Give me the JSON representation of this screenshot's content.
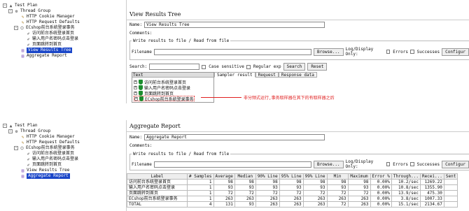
{
  "top": {
    "tree": [
      {
        "label": "Test Plan",
        "icon": "test-plan-icon",
        "indent": 0,
        "expander": "-"
      },
      {
        "label": "Thread Group",
        "icon": "thread-group-icon",
        "indent": 1,
        "expander": "-"
      },
      {
        "label": "HTTP Cookie Manager",
        "icon": "wrench-icon",
        "indent": 2
      },
      {
        "label": "HTTP Request Defaults",
        "icon": "wrench-icon",
        "indent": 2
      },
      {
        "label": "ECshop前台系统登录事务",
        "icon": "transaction-icon",
        "indent": 2,
        "expander": "-"
      },
      {
        "label": "访问前台系统登录首页",
        "icon": "sampler-icon",
        "indent": 3
      },
      {
        "label": "输入用户名密码点击登录",
        "icon": "sampler-icon",
        "indent": 3
      },
      {
        "label": "页面跳转到首页",
        "icon": "sampler-icon",
        "indent": 3
      },
      {
        "label": "View Results Tree",
        "icon": "listener-icon",
        "indent": 2,
        "selected": true
      },
      {
        "label": "Aggregate Report",
        "icon": "listener-icon",
        "indent": 2
      }
    ],
    "title": "View Results Tree",
    "name_label": "Name:",
    "name_value": "View Results Tree",
    "comments_label": "Comments:",
    "group_title": "Write results to file / Read from file",
    "filename_label": "Filename",
    "browse": "Browse...",
    "log_display": "Log/Display Only:",
    "errors": "Errors",
    "successes": "Successes",
    "configure": "Configur",
    "search_label": "Search:",
    "case_sensitive": "Case sensitive",
    "regular_exp": "Regular exp",
    "search_btn": "Search",
    "reset_btn": "Reset",
    "text_header": "Text",
    "results": [
      {
        "label": "访问前台系统登录首页"
      },
      {
        "label": "输入用户名密码点击登录"
      },
      {
        "label": "页面跳转到首页"
      },
      {
        "label": "ECshop前台系统登录事务"
      }
    ],
    "tabs": [
      "Sampler result",
      "Request",
      "Response data"
    ],
    "annotation": "非分频式运行,事务取样器在其下的有取样器之后"
  },
  "bottom": {
    "tree": [
      {
        "label": "Test Plan",
        "icon": "test-plan-icon",
        "indent": 0,
        "expander": "-"
      },
      {
        "label": "Thread Group",
        "icon": "thread-group-icon",
        "indent": 1,
        "expander": "-"
      },
      {
        "label": "HTTP Cookie Manager",
        "icon": "wrench-icon",
        "indent": 2
      },
      {
        "label": "HTTP Request Defaults",
        "icon": "wrench-icon",
        "indent": 2
      },
      {
        "label": "ECshop前台系统登录事务",
        "icon": "transaction-icon",
        "indent": 2,
        "expander": "-"
      },
      {
        "label": "访问前台系统登录首页",
        "icon": "sampler-icon",
        "indent": 3
      },
      {
        "label": "输入用户名密码点击登录",
        "icon": "sampler-icon",
        "indent": 3
      },
      {
        "label": "页面跳转到首页",
        "icon": "sampler-icon",
        "indent": 3
      },
      {
        "label": "View Results Tree",
        "icon": "listener-icon",
        "indent": 2
      },
      {
        "label": "Aggregate Report",
        "icon": "listener-icon",
        "indent": 2,
        "selected": true
      }
    ],
    "title": "Aggregate Report",
    "name_label": "Name:",
    "name_value": "Aggregate Report",
    "comments_label": "Comments:",
    "group_title": "Write results to file / Read from file",
    "filename_label": "Filename",
    "browse": "Browse...",
    "log_display": "Log/Display Only:",
    "errors": "Errors",
    "successes": "Successes",
    "configure": "Configur",
    "columns": [
      "Label",
      "# Samples",
      "Average",
      "Median",
      "90% Line",
      "95% Line",
      "99% Line",
      "Min",
      "Maximum",
      "Error %",
      "Through...",
      "Recei...",
      "Sent"
    ],
    "rows": [
      [
        "访问前台系统登录首页",
        "1",
        "98",
        "98",
        "98",
        "98",
        "98",
        "98",
        "98",
        "0.00%",
        "10.2/sec",
        "1269.22",
        ""
      ],
      [
        "输入用户名密码点击登录",
        "1",
        "93",
        "93",
        "93",
        "93",
        "93",
        "93",
        "93",
        "0.00%",
        "10.8/sec",
        "1355.90",
        ""
      ],
      [
        "页面跳转到首页",
        "1",
        "72",
        "72",
        "72",
        "72",
        "72",
        "72",
        "72",
        "0.00%",
        "13.9/sec",
        "475.30",
        ""
      ],
      [
        "ECshop前台系统登录事务",
        "1",
        "263",
        "263",
        "263",
        "263",
        "263",
        "263",
        "263",
        "0.00%",
        "3.8/sec",
        "1007.33",
        ""
      ],
      [
        "TOTAL",
        "4",
        "131",
        "93",
        "263",
        "263",
        "263",
        "72",
        "263",
        "0.00%",
        "15.1/sec",
        "2134.67",
        ""
      ]
    ]
  }
}
